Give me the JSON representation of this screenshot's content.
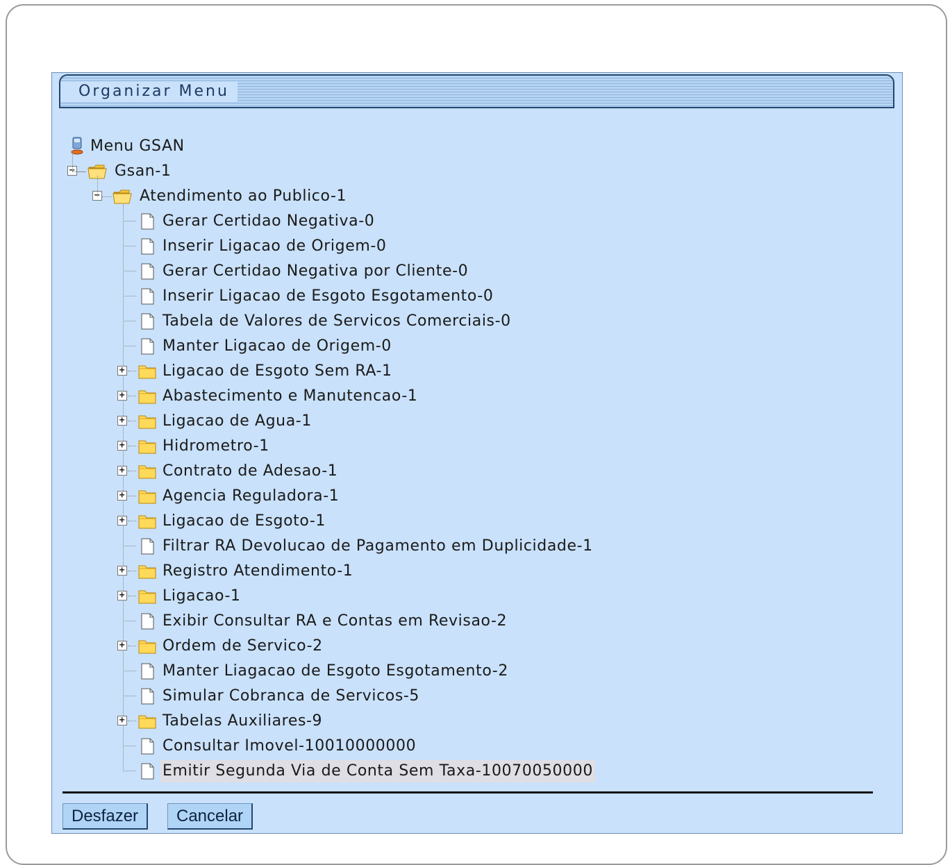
{
  "panel": {
    "title": "Organizar Menu"
  },
  "tree": {
    "root": "Menu GSAN",
    "level1": "Gsan-1",
    "level2": "Atendimento ao Publico-1",
    "children": [
      {
        "label": "Gerar Certidao Negativa-0",
        "type": "file"
      },
      {
        "label": "Inserir Ligacao de Origem-0",
        "type": "file"
      },
      {
        "label": "Gerar Certidao Negativa por Cliente-0",
        "type": "file"
      },
      {
        "label": "Inserir Ligacao de Esgoto Esgotamento-0",
        "type": "file"
      },
      {
        "label": "Tabela de Valores de Servicos Comerciais-0",
        "type": "file"
      },
      {
        "label": "Manter Ligacao de Origem-0",
        "type": "file"
      },
      {
        "label": "Ligacao de Esgoto Sem RA-1",
        "type": "folder"
      },
      {
        "label": "Abastecimento e Manutencao-1",
        "type": "folder"
      },
      {
        "label": "Ligacao de Agua-1",
        "type": "folder"
      },
      {
        "label": "Hidrometro-1",
        "type": "folder"
      },
      {
        "label": "Contrato de Adesao-1",
        "type": "folder"
      },
      {
        "label": "Agencia Reguladora-1",
        "type": "folder"
      },
      {
        "label": "Ligacao de Esgoto-1",
        "type": "folder"
      },
      {
        "label": "Filtrar RA Devolucao de Pagamento em Duplicidade-1",
        "type": "file"
      },
      {
        "label": "Registro Atendimento-1",
        "type": "folder"
      },
      {
        "label": "Ligacao-1",
        "type": "folder"
      },
      {
        "label": "Exibir Consultar RA e Contas em Revisao-2",
        "type": "file"
      },
      {
        "label": "Ordem de Servico-2",
        "type": "folder"
      },
      {
        "label": "Manter Liagacao de Esgoto Esgotamento-2",
        "type": "file"
      },
      {
        "label": "Simular Cobranca de Servicos-5",
        "type": "file"
      },
      {
        "label": "Tabelas Auxiliares-9",
        "type": "folder"
      },
      {
        "label": "Consultar Imovel-10010000000",
        "type": "file"
      },
      {
        "label": "Emitir Segunda Via de Conta Sem Taxa-10070050000",
        "type": "file",
        "selected": true
      }
    ]
  },
  "buttons": {
    "undo": "Desfazer",
    "cancel": "Cancelar"
  },
  "colors": {
    "panel_bg": "#c9e1fa",
    "title_border": "#24466e",
    "button_bg": "#b0d4f6",
    "selected_bg": "#dedee4"
  }
}
